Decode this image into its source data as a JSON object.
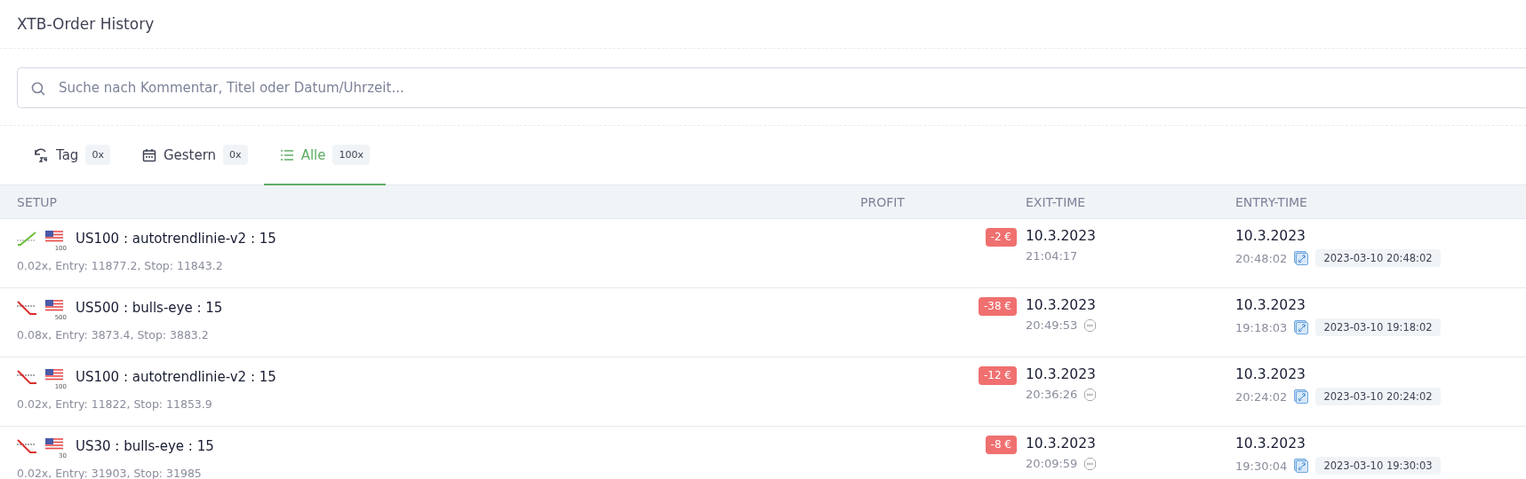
{
  "title": "XTB-Order History",
  "search": {
    "placeholder": "Suche nach Kommentar, Titel oder Datum/Uhrzeit..."
  },
  "tabs": [
    {
      "kind": "day",
      "label": "Tag",
      "count": "0x",
      "selected": false
    },
    {
      "kind": "calendar",
      "label": "Gestern",
      "count": "0x",
      "selected": false
    },
    {
      "kind": "list",
      "label": "Alle",
      "count": "100x",
      "selected": true
    }
  ],
  "table": {
    "columns": [
      "SETUP",
      "PROFIT",
      "EXIT-TIME",
      "ENTRY-TIME"
    ],
    "rows": [
      {
        "kind": "long",
        "flag_label": "100",
        "title": "US100 : autotrendlinie-v2 : 15",
        "details": "0.02x, Entry: 11877.2, Stop: 11843.2",
        "profit": "-2 €",
        "exit_date": "10.3.2023",
        "exit_time": "21:04:17",
        "stop": false,
        "entry_date": "10.3.2023",
        "entry_time": "20:48:02",
        "entry_stamp": "2023-03-10 20:48:02"
      },
      {
        "kind": "short",
        "flag_label": "500",
        "title": "US500 : bulls-eye : 15",
        "details": "0.08x, Entry: 3873.4, Stop: 3883.2",
        "profit": "-38 €",
        "exit_date": "10.3.2023",
        "exit_time": "20:49:53",
        "stop": true,
        "entry_date": "10.3.2023",
        "entry_time": "19:18:03",
        "entry_stamp": "2023-03-10 19:18:02"
      },
      {
        "kind": "short",
        "flag_label": "100",
        "title": "US100 : autotrendlinie-v2 : 15",
        "details": "0.02x, Entry: 11822, Stop: 11853.9",
        "profit": "-12 €",
        "exit_date": "10.3.2023",
        "exit_time": "20:36:26",
        "stop": true,
        "entry_date": "10.3.2023",
        "entry_time": "20:24:02",
        "entry_stamp": "2023-03-10 20:24:02"
      },
      {
        "kind": "short",
        "flag_label": "30",
        "title": "US30 : bulls-eye : 15",
        "details": "0.02x, Entry: 31903, Stop: 31985",
        "profit": "-8 €",
        "exit_date": "10.3.2023",
        "exit_time": "20:09:59",
        "stop": true,
        "entry_date": "10.3.2023",
        "entry_time": "19:30:04",
        "entry_stamp": "2023-03-10 19:30:03"
      }
    ]
  }
}
